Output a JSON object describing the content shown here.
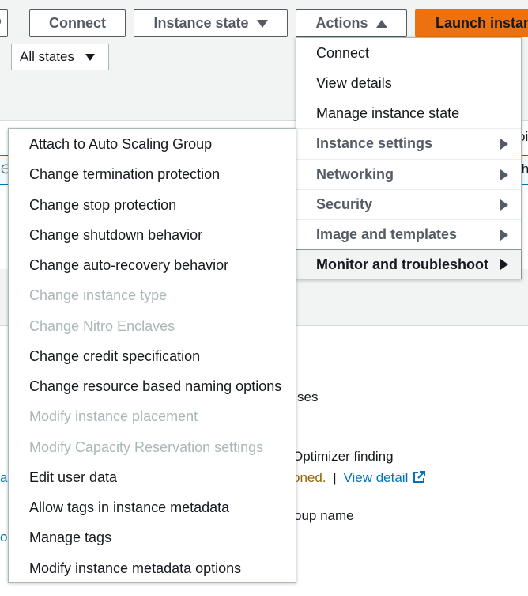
{
  "toolbar": {
    "connect_label": "Connect",
    "instance_state_label": "Instance state",
    "actions_label": "Actions",
    "launch_label": "Launch instanc",
    "refresh_icon": "refresh-icon"
  },
  "filter": {
    "states_label": "All states"
  },
  "actions_menu": {
    "items": [
      {
        "label": "Connect",
        "type": "item"
      },
      {
        "label": "View details",
        "type": "item"
      },
      {
        "label": "Manage instance state",
        "type": "item"
      },
      {
        "label": "Instance settings",
        "type": "group"
      },
      {
        "label": "Networking",
        "type": "group"
      },
      {
        "label": "Security",
        "type": "group"
      },
      {
        "label": "Image and templates",
        "type": "group"
      },
      {
        "label": "Monitor and troubleshoot",
        "type": "group-active"
      }
    ]
  },
  "instance_settings_menu": {
    "items": [
      {
        "label": "Attach to Auto Scaling Group",
        "disabled": false
      },
      {
        "label": "Change termination protection",
        "disabled": false
      },
      {
        "label": "Change stop protection",
        "disabled": false
      },
      {
        "label": "Change shutdown behavior",
        "disabled": false
      },
      {
        "label": "Change auto-recovery behavior",
        "disabled": false
      },
      {
        "label": "Change instance type",
        "disabled": true
      },
      {
        "label": "Change Nitro Enclaves",
        "disabled": true
      },
      {
        "label": "Change credit specification",
        "disabled": false
      },
      {
        "label": "Change resource based naming options",
        "disabled": false
      },
      {
        "label": "Modify instance placement",
        "disabled": true
      },
      {
        "label": "Modify Capacity Reservation settings",
        "disabled": true
      },
      {
        "label": "Edit user data",
        "disabled": false
      },
      {
        "label": "Allow tags in instance metadata",
        "disabled": false
      },
      {
        "label": "Manage tags",
        "disabled": false
      },
      {
        "label": "Modify instance metadata options",
        "disabled": false
      }
    ]
  },
  "background": {
    "row_peek_1": "oi",
    "row_peek_2": "th",
    "addresses_tail": "ses",
    "optimizer_label": "Optimizer finding",
    "optimizer_status": "oned.",
    "separator": "|",
    "view_detail_link": "View detail",
    "group_name_label": "oup name",
    "left_peek_1": "a-",
    "left_peek_2": "ol"
  },
  "colors": {
    "accent_orange": "#ec7211",
    "link_blue": "#0073bb",
    "warning_text": "#8d6605",
    "disabled_text": "#aab7b8"
  }
}
